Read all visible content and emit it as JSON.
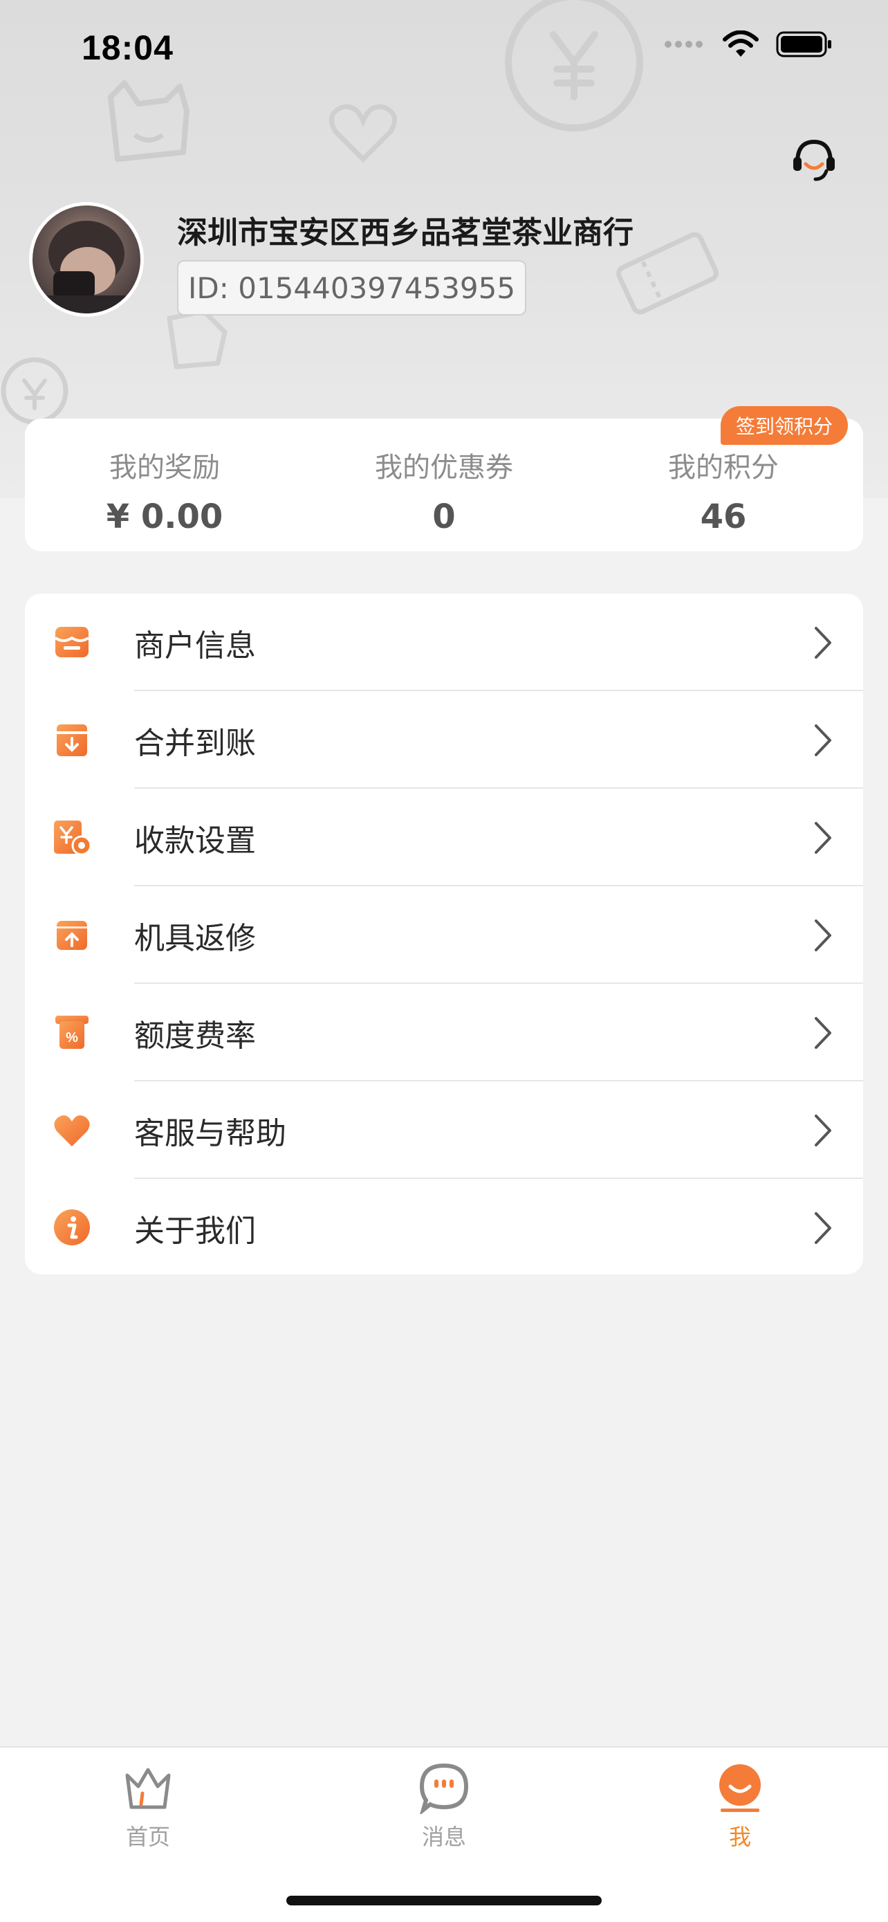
{
  "status_bar": {
    "time": "18:04"
  },
  "profile": {
    "merchant_name": "深圳市宝安区西乡品茗堂茶业商行",
    "merchant_id": "ID: 015440397453955"
  },
  "stats": {
    "signin_badge": "签到领积分",
    "items": [
      {
        "label": "我的奖励",
        "value": "¥ 0.00"
      },
      {
        "label": "我的优惠券",
        "value": "0"
      },
      {
        "label": "我的积分",
        "value": "46"
      }
    ]
  },
  "menu": {
    "items": [
      {
        "label": "商户信息",
        "icon": "store-icon"
      },
      {
        "label": "合并到账",
        "icon": "merge-download-icon"
      },
      {
        "label": "收款设置",
        "icon": "payment-settings-icon"
      },
      {
        "label": "机具返修",
        "icon": "device-repair-icon"
      },
      {
        "label": "额度费率",
        "icon": "rate-percent-icon"
      },
      {
        "label": "客服与帮助",
        "icon": "heart-icon"
      },
      {
        "label": "关于我们",
        "icon": "info-icon"
      }
    ]
  },
  "tabbar": {
    "tabs": [
      {
        "label": "首页",
        "icon": "home-crown-icon",
        "active": false
      },
      {
        "label": "消息",
        "icon": "message-icon",
        "active": false
      },
      {
        "label": "我",
        "icon": "profile-smile-icon",
        "active": true
      }
    ]
  },
  "colors": {
    "accent": "#f47c38",
    "active_tab": "#f08a2a"
  }
}
